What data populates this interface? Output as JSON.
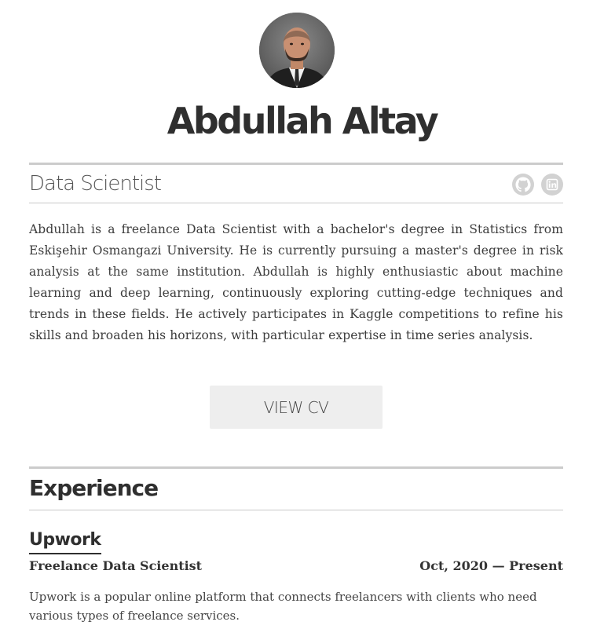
{
  "profile": {
    "name": "Abdullah Altay",
    "role": "Data Scientist",
    "bio": "Abdullah is a freelance Data Scientist with a bachelor's degree in Statistics from Eskişehir Osmangazi University. He is currently pursuing a master's degree in risk analysis at the same institution. Abdullah is highly enthusiastic about machine learning and deep learning, continuously exploring cutting-edge techniques and trends in these fields. He actively participates in Kaggle competitions to refine his skills and broaden his horizons, with particular expertise in time series analysis.",
    "cv_button_label": "VIEW CV"
  },
  "social": [
    {
      "icon": "github-icon"
    },
    {
      "icon": "linkedin-icon"
    }
  ],
  "experience": {
    "heading": "Experience",
    "items": [
      {
        "company": "Upwork",
        "title": "Freelance Data Scientist",
        "dates": "Oct, 2020 — Present",
        "description": "Upwork is a popular online platform that connects freelancers with clients who need various types of freelance services."
      }
    ]
  },
  "colors": {
    "text": "#333333",
    "rule": "#cccccc",
    "button_bg": "#eeeeee",
    "icon_bg": "#d2d2d2"
  }
}
